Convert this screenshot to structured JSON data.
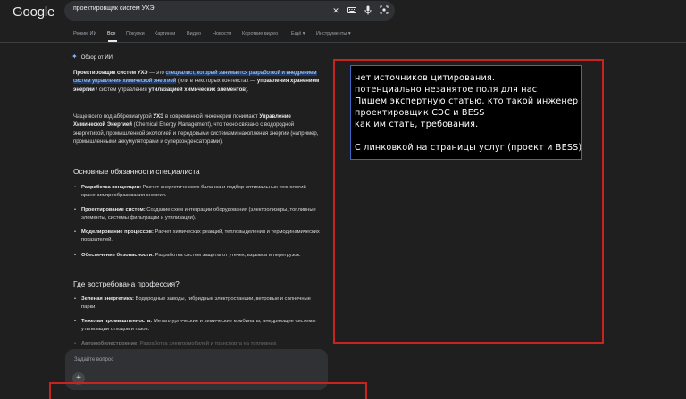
{
  "header": {
    "logo": "Google",
    "search_query": "проектировщик систем УХЭ"
  },
  "icons": {
    "clear": "close-icon",
    "keyboard": "keyboard-icon",
    "mic": "mic-icon",
    "lens": "lens-icon"
  },
  "tabs": [
    "Режим ИИ",
    "Все",
    "Покупки",
    "Картинки",
    "Видео",
    "Новости",
    "Короткие видео",
    "Ещё ▾",
    "Инструменты ▾"
  ],
  "active_tab": "Все",
  "ai_overview": {
    "heading": "Обзор от ИИ",
    "p1_bold": "Проектировщик систем УХЭ",
    "p1_dash": " — это ",
    "p1_highlight": "специалист, который занимается разработкой и внедрением систем управления химической энергией",
    "p1_rest": " (или в некоторых контекстах — ",
    "p1_bold2": "управления хранением энергии",
    "p1_rest2": " / систем управления ",
    "p1_bold3": "утилизацией химических элементов",
    "p1_end": ").",
    "p2_a": "Чаще всего под аббревиатурой ",
    "p2_b": "УХЭ",
    "p2_c": " в современной инженерии понимают ",
    "p2_d": "Управление Химической Энергией",
    "p2_e": " (Chemical Energy Management), что тесно связано с водородной энергетикой, промышленной экологией и передовыми системами накопления энергии (например, промышленными аккумуляторами и суперконденсаторами).",
    "section1_title": "Основные обязанности специалиста",
    "duties": [
      {
        "title": "Разработка концепции:",
        "text": " Расчет энергетического баланса и подбор оптимальных технологий хранения/преобразования энергии."
      },
      {
        "title": "Проектирование систем:",
        "text": " Создание схем интеграции оборудования (электролизеры, топливные элементы, системы фильтрации и утилизации)."
      },
      {
        "title": "Моделирование процессов:",
        "text": " Расчет химических реакций, тепловыделения и термодинамических показателей."
      },
      {
        "title": "Обеспечение безопасности:",
        "text": " Разработка систем защиты от утечек, взрывов и перегрузок."
      }
    ],
    "section2_title": "Где востребована профессия?",
    "demand": [
      {
        "title": "Зеленая энергетика:",
        "text": " Водородные заводы, гибридные электростанции, ветровые и солнечные парки."
      },
      {
        "title": "Тяжелая промышленность:",
        "text": " Металлургические и химические комбинаты, внедряющие системы утилизации отходов и газов."
      },
      {
        "title": "Автомобилестроение:",
        "text": " Разработка электромобилей и транспорта на топливных"
      }
    ]
  },
  "ask": {
    "placeholder": "Задайте вопрос",
    "plus": "+"
  },
  "note": {
    "lines": [
      "нет источников цитирования.",
      "потенциальнo незанятое поля для нас",
      "Пишем экспертную статью, кто такой инженер",
      "проектировщик СЭС и BESS",
      "как им стать, требования.",
      "",
      "С линковкой на страницы услуг (проект и BESS)"
    ]
  },
  "colors": {
    "background": "#1f1f1f",
    "highlight": "#1a3a6e",
    "annotation_red": "#c8231f",
    "note_border": "#3a66c4"
  }
}
